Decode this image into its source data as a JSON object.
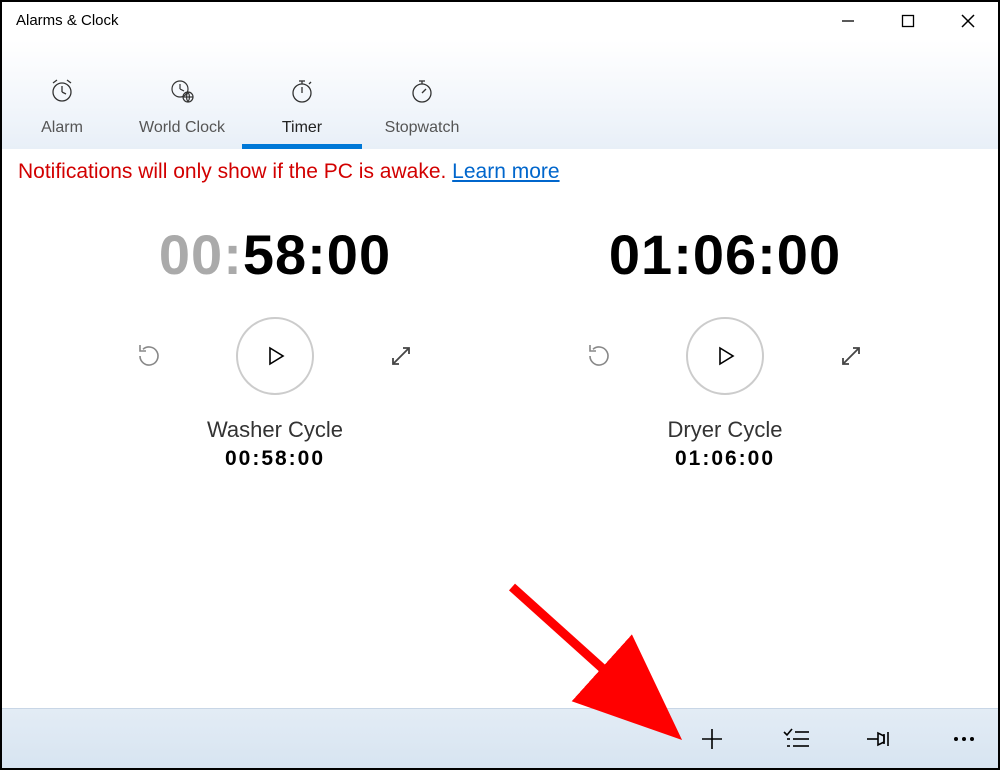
{
  "window": {
    "title": "Alarms & Clock"
  },
  "tabs": {
    "alarm": {
      "label": "Alarm"
    },
    "worldclock": {
      "label": "World Clock"
    },
    "timer": {
      "label": "Timer"
    },
    "stopwatch": {
      "label": "Stopwatch"
    },
    "selected": "timer"
  },
  "notification": {
    "text": "Notifications will only show if the PC is awake. ",
    "link": "Learn more"
  },
  "timers": [
    {
      "display_h": "00",
      "display_m": "58",
      "display_s": "00",
      "hours_muted": true,
      "name": "Washer Cycle",
      "duration": "00:58:00"
    },
    {
      "display_h": "01",
      "display_m": "06",
      "display_s": "00",
      "hours_muted": false,
      "name": "Dryer Cycle",
      "duration": "01:06:00"
    }
  ]
}
